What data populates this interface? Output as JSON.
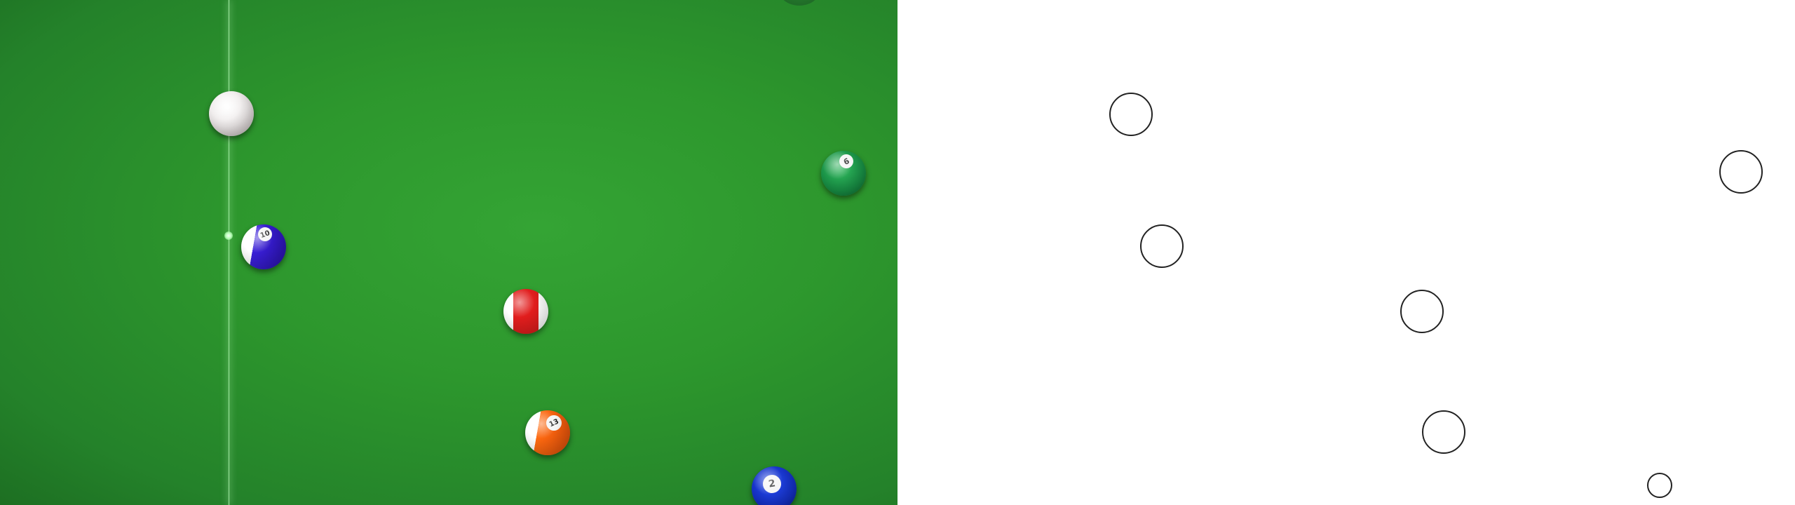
{
  "scene": {
    "felt_color": "#2e9a33",
    "aim_line_color": "#bfffbf"
  },
  "balls": [
    {
      "id": "cue",
      "kind": "cue",
      "number": "",
      "color": "#f2eeee"
    },
    {
      "id": "blue-stripe",
      "kind": "stripe",
      "number": "10",
      "color": "#2b13b0"
    },
    {
      "id": "green-solid",
      "kind": "solid",
      "number": "6",
      "color": "#189045"
    },
    {
      "id": "red-stripe",
      "kind": "stripe",
      "number": "",
      "color": "#e11d1d"
    },
    {
      "id": "orange-stripe",
      "kind": "stripe",
      "number": "13",
      "color": "#ff6a10"
    },
    {
      "id": "blue-solid",
      "kind": "solid",
      "number": "2",
      "color": "#1430c4"
    }
  ],
  "overlay": {
    "panel_background": "#ffffff",
    "marker_color": "#222222",
    "marker_count": 6
  }
}
